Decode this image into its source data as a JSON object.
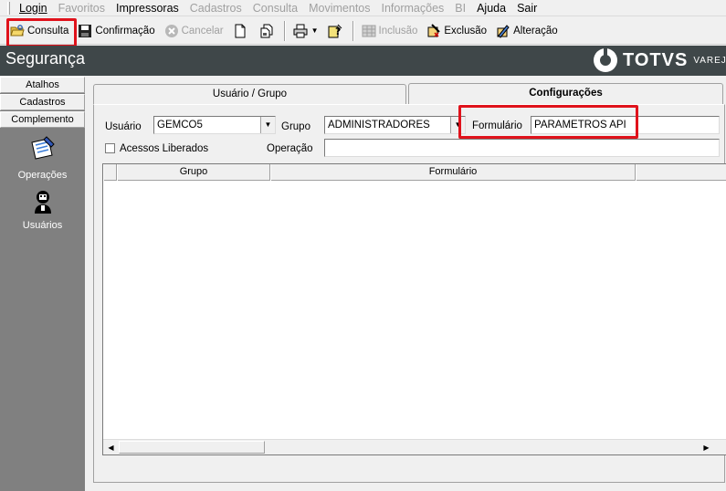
{
  "menu": {
    "items": [
      {
        "label": "Login",
        "disabled": false
      },
      {
        "label": "Favoritos",
        "disabled": true
      },
      {
        "label": "Impressoras",
        "disabled": false
      },
      {
        "label": "Cadastros",
        "disabled": true
      },
      {
        "label": "Consulta",
        "disabled": true
      },
      {
        "label": "Movimentos",
        "disabled": true
      },
      {
        "label": "Informações",
        "disabled": true
      },
      {
        "label": "BI",
        "disabled": true
      },
      {
        "label": "Ajuda",
        "disabled": false
      },
      {
        "label": "Sair",
        "disabled": false
      }
    ]
  },
  "toolbar": {
    "consulta": "Consulta",
    "confirmacao": "Confirmação",
    "cancelar": "Cancelar",
    "inclusao": "Inclusão",
    "exclusao": "Exclusão",
    "alteracao": "Alteração"
  },
  "header": {
    "title": "Segurança",
    "brand": "TOTVS",
    "brand_sub": "VAREJO"
  },
  "sidebar": {
    "tabs": [
      "Atalhos",
      "Cadastros",
      "Complemento"
    ],
    "items": [
      "Operações",
      "Usuários"
    ]
  },
  "tabs": {
    "usuario_grupo": "Usuário  / Grupo",
    "configuracoes": "Configurações"
  },
  "form": {
    "usuario_label": "Usuário",
    "usuario_value": "GEMCO5",
    "grupo_label": "Grupo",
    "grupo_value": "ADMINISTRADORES",
    "formulario_label": "Formulário",
    "formulario_value": "PARAMETROS API",
    "acessos_label": "Acessos Liberados",
    "operacao_label": "Operação",
    "operacao_value": ""
  },
  "grid": {
    "columns": [
      "Grupo",
      "Formulário"
    ]
  },
  "colors": {
    "header_bg": "#3f4749",
    "highlight": "#e0121b",
    "sidebar_bg": "#808080"
  }
}
